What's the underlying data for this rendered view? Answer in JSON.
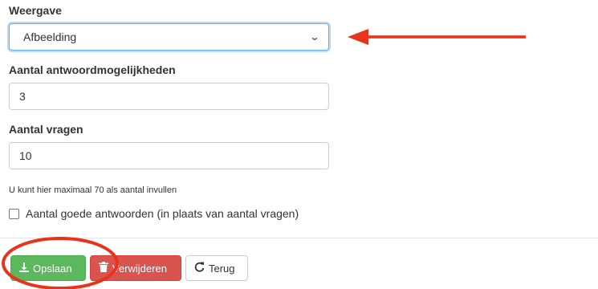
{
  "weergave": {
    "label": "Weergave",
    "selected": "Afbeelding"
  },
  "antwoordmogelijkheden": {
    "label": "Aantal antwoordmogelijkheden",
    "value": "3"
  },
  "vragen": {
    "label": "Aantal vragen",
    "value": "10"
  },
  "help_text": "U kunt hier maximaal 70 als aantal invullen",
  "checkbox": {
    "label": "Aantal goede antwoorden (in plaats van aantal vragen)",
    "checked": false
  },
  "buttons": {
    "save": "Opslaan",
    "delete": "Verwijderen",
    "back": "Terug"
  },
  "icons": {
    "save": "download-icon",
    "delete": "trash-icon",
    "back": "refresh-icon",
    "select": "chevron-down-icon"
  },
  "colors": {
    "save": "#5cb85c",
    "delete": "#d9534f",
    "annotation": "#e8331c",
    "focus": "#66afe9"
  }
}
